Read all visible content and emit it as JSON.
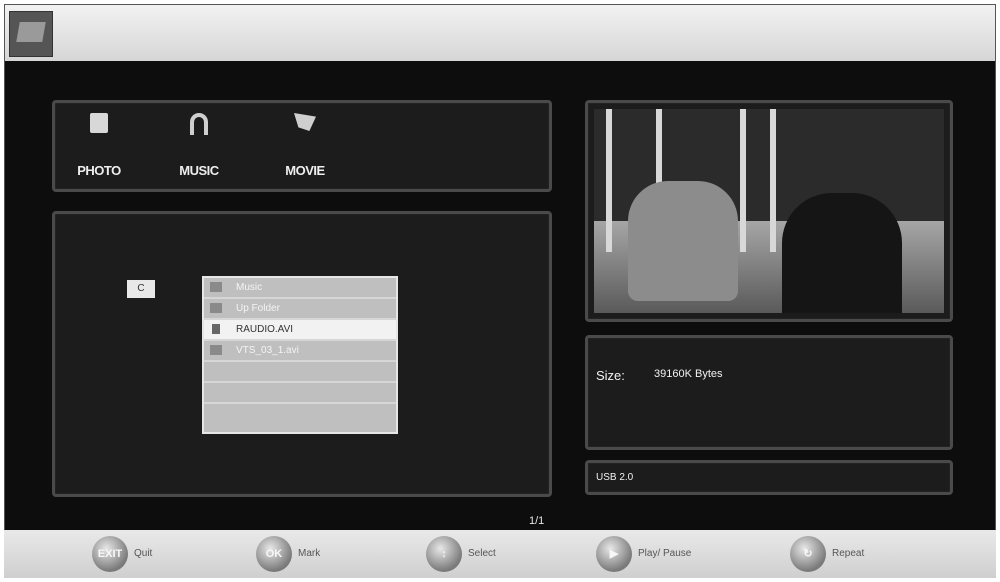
{
  "media_tabs": [
    {
      "label": "PHOTO",
      "icon": "photo-icon"
    },
    {
      "label": "MUSIC",
      "icon": "music-icon"
    },
    {
      "label": "MOVIE",
      "icon": "movie-icon"
    }
  ],
  "browser": {
    "drive": "C",
    "files": [
      {
        "name": "Music",
        "icon": "folder-icon"
      },
      {
        "name": "Up Folder",
        "icon": "up-folder-icon"
      },
      {
        "name": "RAUDIO.AVI",
        "icon": "video-file-icon",
        "selected": true
      },
      {
        "name": "VTS_03_1.avi",
        "icon": "video-file-icon"
      },
      {
        "name": ""
      },
      {
        "name": ""
      },
      {
        "name": ""
      }
    ]
  },
  "info": {
    "size_label": "Size:",
    "size_value": "39160K Bytes"
  },
  "device": {
    "label": "USB 2.0"
  },
  "page_indicator": "1/1",
  "bottom_buttons": [
    {
      "key": "EXIT",
      "label": "Quit"
    },
    {
      "key": "OK",
      "label": "Mark"
    },
    {
      "key": "",
      "label": "Select"
    },
    {
      "key": "",
      "label": "Play/ Pause"
    },
    {
      "key": "",
      "label": "Repeat"
    }
  ]
}
